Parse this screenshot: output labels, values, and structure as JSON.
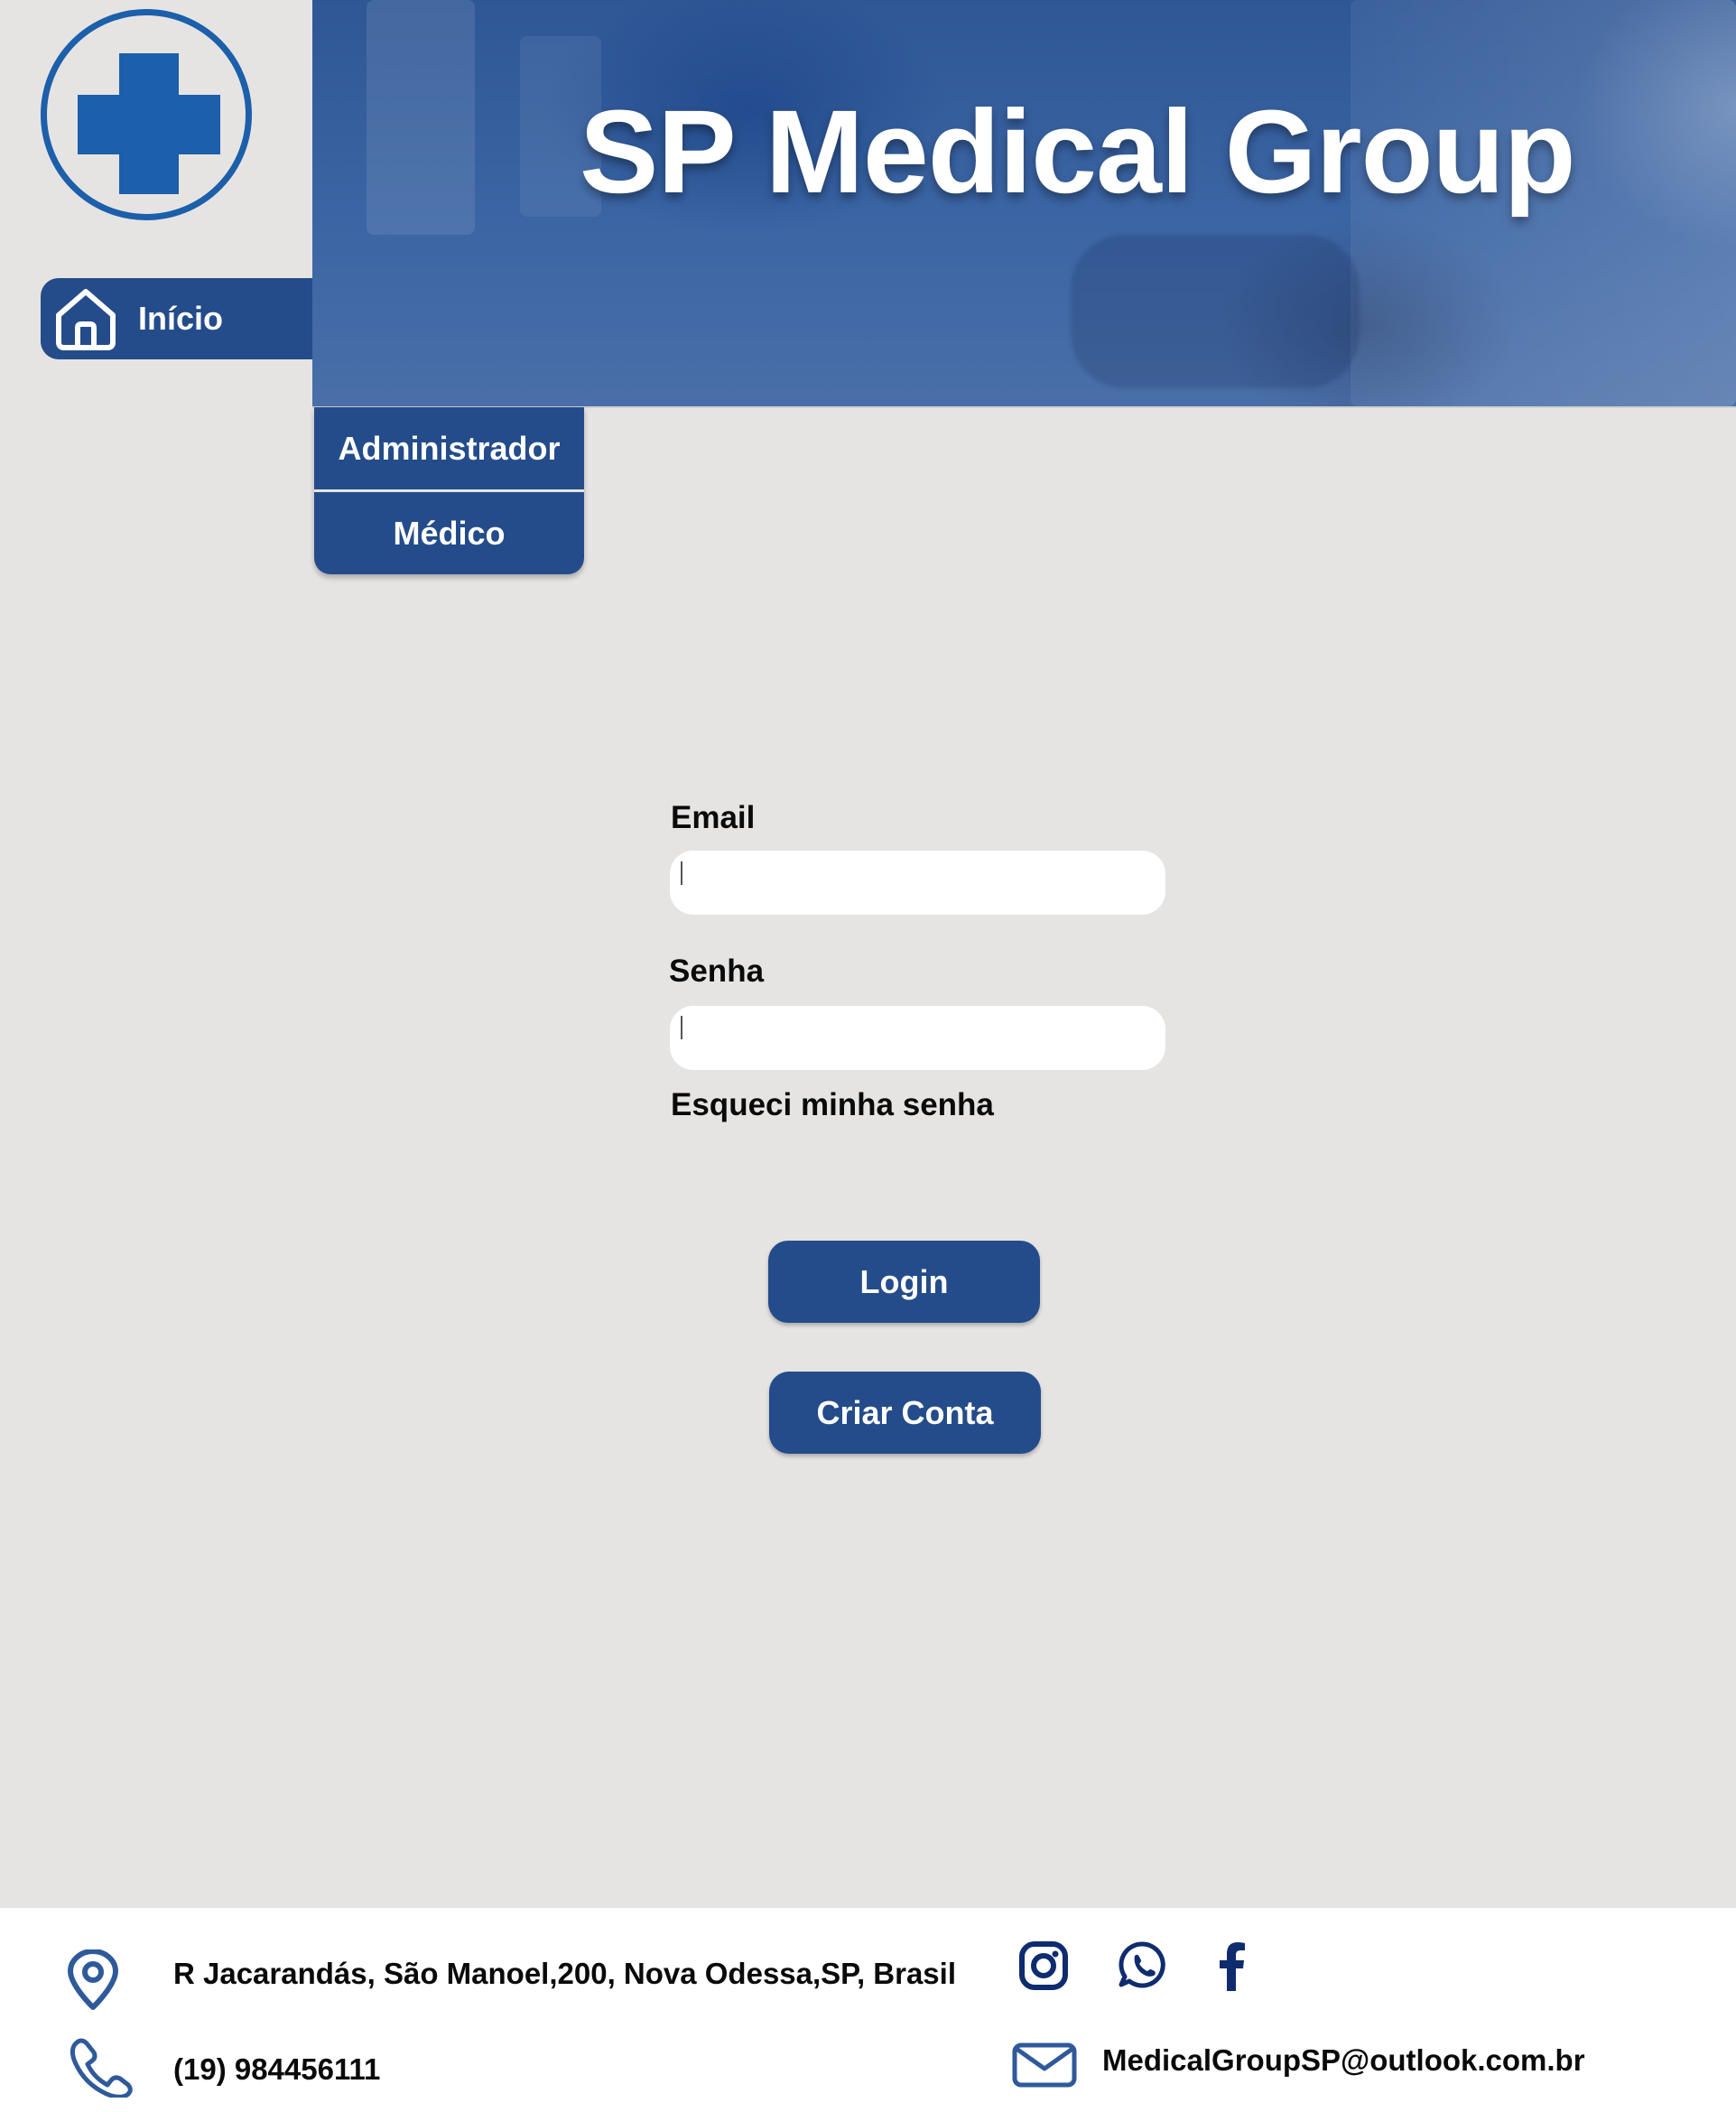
{
  "header": {
    "title": "SP Medical Group"
  },
  "logo": {
    "icon": "medical-cross-icon",
    "color": "#1c5faa"
  },
  "nav": {
    "home": {
      "label": "Início",
      "icon": "home-icon"
    },
    "dropdown": [
      {
        "label": "Administrador"
      },
      {
        "label": "Médico"
      }
    ]
  },
  "login_form": {
    "email_label": "Email",
    "email_value": "",
    "password_label": "Senha",
    "password_value": "",
    "forgot_label": "Esqueci minha senha",
    "login_label": "Login",
    "create_label": "Criar Conta"
  },
  "footer": {
    "address": "R Jacarandás, São Manoel,200, Nova Odessa,SP, Brasil",
    "phone": "(19) 984456111",
    "email": "MedicalGroupSP@outlook.com.br",
    "social": [
      "instagram-icon",
      "whatsapp-icon",
      "facebook-icon"
    ]
  },
  "colors": {
    "primary": "#244c8a",
    "background": "#e6e4e3",
    "footer_icon": "#0f2c6e"
  }
}
